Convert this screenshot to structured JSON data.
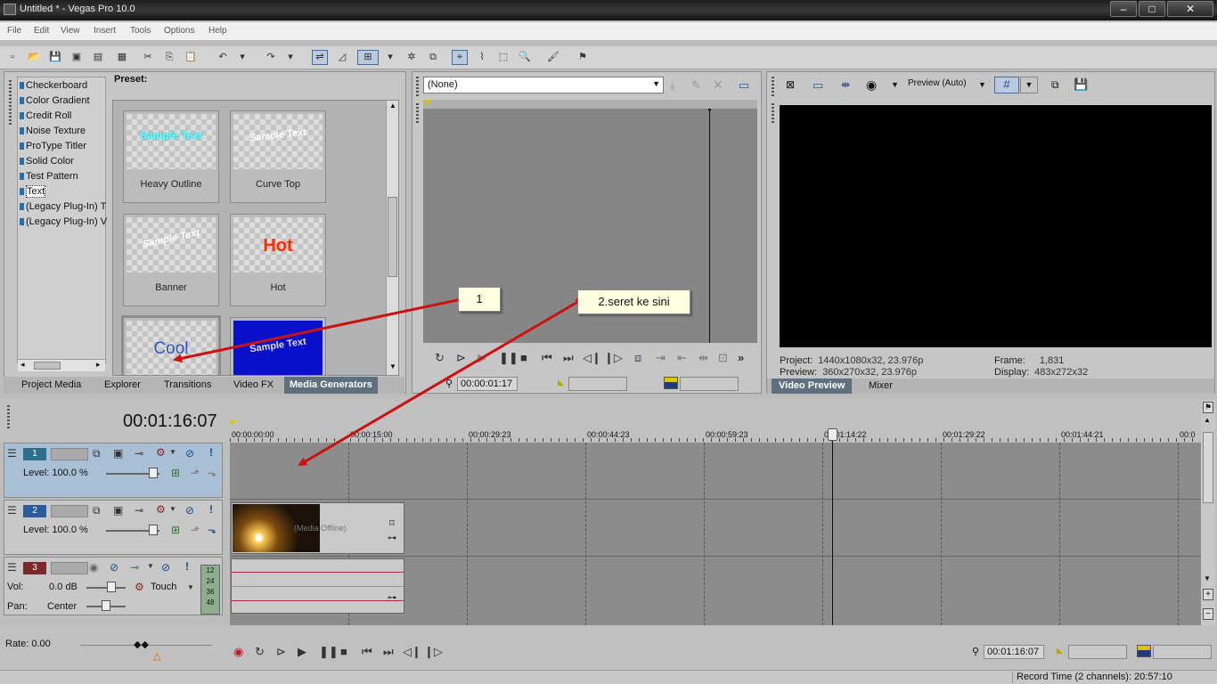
{
  "window": {
    "title": "Untitled * - Vegas Pro 10.0",
    "buttons": [
      "–",
      "□",
      "✕"
    ]
  },
  "menu": [
    "File",
    "Edit",
    "View",
    "Insert",
    "Tools",
    "Options",
    "Help"
  ],
  "generators": {
    "items": [
      "Checkerboard",
      "Color Gradient",
      "Credit Roll",
      "Noise Texture",
      "ProType Titler",
      "Solid Color",
      "Test Pattern",
      "Text",
      "(Legacy Plug-In) T",
      "(Legacy Plug-In) V"
    ],
    "selected": "Text",
    "preset_label": "Preset:",
    "presets": [
      {
        "caption": "Heavy Outline",
        "sample": "Sample Text"
      },
      {
        "caption": "Curve Top",
        "sample": "Sample Text"
      },
      {
        "caption": "Banner",
        "sample": "Sample Text"
      },
      {
        "caption": "Hot",
        "sample": "Hot"
      },
      {
        "caption": "",
        "sample": "Cool"
      },
      {
        "caption": "",
        "sample": "Sample Text"
      }
    ]
  },
  "left_tabs": [
    "Project Media",
    "Explorer",
    "Transitions",
    "Video FX",
    "Media Generators"
  ],
  "trimmer": {
    "selection": "(None)",
    "timecode": "00:00:01:17"
  },
  "preview": {
    "mode": "Preview (Auto)",
    "project_label": "Project:",
    "project_value": "1440x1080x32, 23.976p",
    "preview_label": "Preview:",
    "preview_value": "360x270x32, 23.976p",
    "frame_label": "Frame:",
    "frame_value": "1,831",
    "display_label": "Display:",
    "display_value": "483x272x32",
    "tabs": [
      "Video Preview",
      "Mixer"
    ]
  },
  "timeline": {
    "timecode": "00:01:16:07",
    "ruler": [
      "00:00:00:00",
      "00:00:15:00",
      "00:00:29:23",
      "00:00:44:23",
      "00:00:59:23",
      "00:01:14:22",
      "00:01:29:22",
      "00:01:44:21",
      "00:0"
    ],
    "tracks": [
      {
        "number": "1",
        "level": "Level: 100.0 %"
      },
      {
        "number": "2",
        "level": "Level: 100.0 %"
      },
      {
        "number": "3",
        "vol_label": "Vol:",
        "vol_value": "0.0 dB",
        "pan_label": "Pan:",
        "pan_value": "Center",
        "mode": "Touch",
        "meter": [
          "12",
          "24",
          "36",
          "48"
        ]
      }
    ],
    "clip_label": "(Media Offline)"
  },
  "transport": {
    "rate": "Rate: 0.00",
    "timecode": "00:01:16:07"
  },
  "status": {
    "record_time": "Record Time (2 channels): 20:57:10"
  },
  "annotations": [
    {
      "label": "1"
    },
    {
      "label": "2.seret ke sini"
    }
  ],
  "colors": {
    "annotation_arrow": "#cc1111",
    "track_selected": "#a9bfd6",
    "title_bar": "#1e1e1e",
    "hot_text": "#ff2a00",
    "cool_text": "#2c54c8"
  }
}
